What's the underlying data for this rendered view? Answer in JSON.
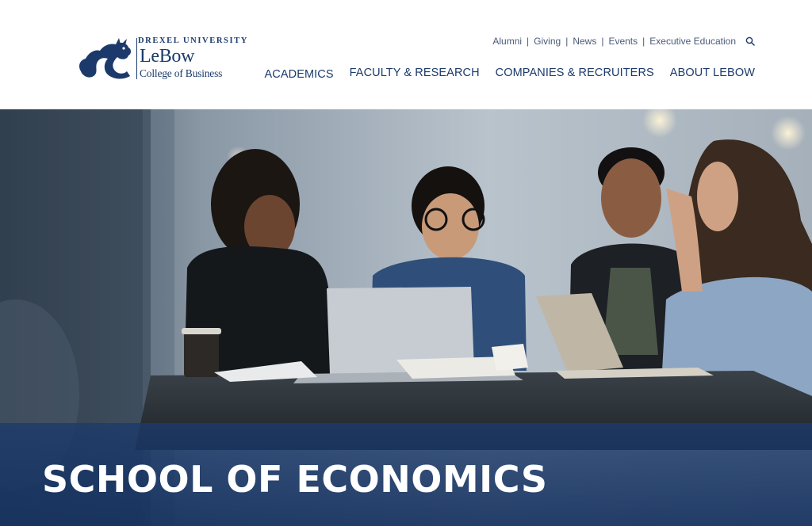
{
  "logo": {
    "university": "DREXEL UNIVERSITY",
    "name": "LeBow",
    "college": "College of Business"
  },
  "utility_nav": {
    "items": [
      "Alumni",
      "Giving",
      "News",
      "Events",
      "Executive Education"
    ],
    "search_icon": "search-icon"
  },
  "main_nav": {
    "items": [
      "ACADEMICS",
      "FACULTY & RESEARCH",
      "COMPANIES & RECRUITERS",
      "ABOUT LEBOW"
    ]
  },
  "hero": {
    "title": "SCHOOL OF ECONOMICS"
  },
  "colors": {
    "brand_navy": "#1b3a6b",
    "utility_text": "#4a5a78",
    "band": "#1b3a6b"
  }
}
